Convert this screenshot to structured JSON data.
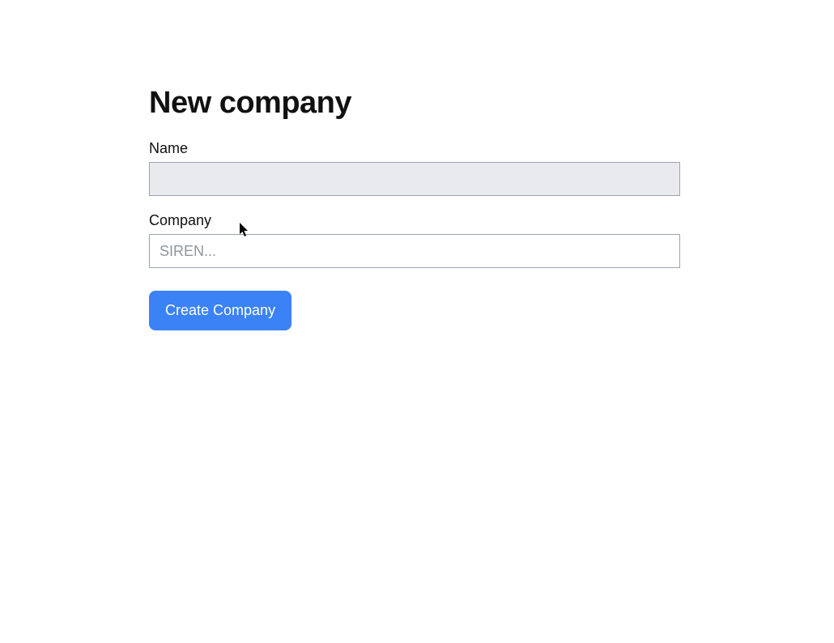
{
  "page": {
    "title": "New company"
  },
  "form": {
    "name": {
      "label": "Name",
      "value": ""
    },
    "company": {
      "label": "Company",
      "placeholder": "SIREN...",
      "value": ""
    },
    "submit_label": "Create Company"
  },
  "colors": {
    "primary": "#3b82f6",
    "text": "#111111",
    "border": "#9ca3af",
    "disabled_bg": "#e9eaed",
    "placeholder": "#8f959e"
  }
}
